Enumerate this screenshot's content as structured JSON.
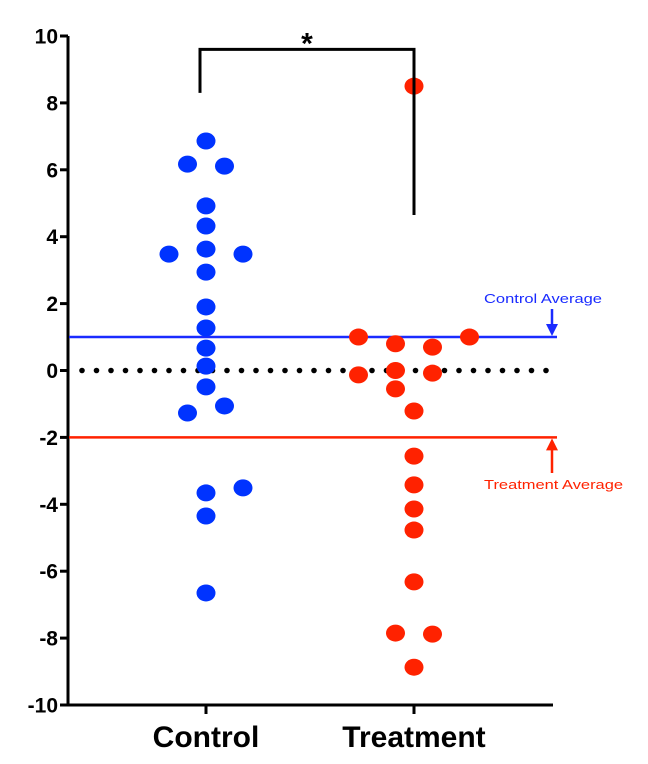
{
  "chart_data": {
    "type": "scatter",
    "title": "",
    "xlabel": "",
    "ylabel": "",
    "ylim": [
      -10,
      10
    ],
    "yticks": [
      10,
      8,
      6,
      4,
      2,
      0,
      -2,
      -4,
      -6,
      -8,
      -10
    ],
    "grid": false,
    "categories": [
      "Control",
      "Treatment"
    ],
    "series": [
      {
        "name": "Control",
        "color": "#0033ff",
        "points": [
          {
            "offset": 0,
            "y": 6.86
          },
          {
            "offset": -1,
            "y": 6.17
          },
          {
            "offset": 1,
            "y": 6.11
          },
          {
            "offset": 0,
            "y": 4.92
          },
          {
            "offset": 0,
            "y": 4.32
          },
          {
            "offset": 0,
            "y": 3.63
          },
          {
            "offset": -2,
            "y": 3.48
          },
          {
            "offset": 2,
            "y": 3.48
          },
          {
            "offset": 0,
            "y": 2.94
          },
          {
            "offset": 0,
            "y": 1.9
          },
          {
            "offset": 0,
            "y": 1.27
          },
          {
            "offset": 0,
            "y": 0.67
          },
          {
            "offset": 0,
            "y": 0.13
          },
          {
            "offset": 0,
            "y": -0.49
          },
          {
            "offset": 1,
            "y": -1.06
          },
          {
            "offset": -1,
            "y": -1.27
          },
          {
            "offset": 2,
            "y": -3.51
          },
          {
            "offset": 0,
            "y": -3.66
          },
          {
            "offset": 0,
            "y": -4.35
          },
          {
            "offset": 0,
            "y": -6.65
          }
        ]
      },
      {
        "name": "Treatment",
        "color": "#ff2200",
        "points": [
          {
            "offset": 0,
            "y": 8.5
          },
          {
            "offset": -3,
            "y": 1.0
          },
          {
            "offset": 3,
            "y": 1.0
          },
          {
            "offset": -1,
            "y": 0.8
          },
          {
            "offset": 1,
            "y": 0.7
          },
          {
            "offset": -1,
            "y": 0.0
          },
          {
            "offset": 1,
            "y": -0.08
          },
          {
            "offset": -3,
            "y": -0.13
          },
          {
            "offset": -1,
            "y": -0.55
          },
          {
            "offset": 0,
            "y": -1.21
          },
          {
            "offset": 0,
            "y": -2.56
          },
          {
            "offset": 0,
            "y": -3.42
          },
          {
            "offset": 0,
            "y": -4.14
          },
          {
            "offset": 0,
            "y": -4.77
          },
          {
            "offset": 0,
            "y": -6.32
          },
          {
            "offset": -1,
            "y": -7.85
          },
          {
            "offset": 1,
            "y": -7.88
          },
          {
            "offset": 0,
            "y": -8.87
          }
        ]
      }
    ],
    "reference_lines": [
      {
        "name": "Control Average",
        "y": 1,
        "color": "#1a2bff",
        "style": "solid",
        "label": "Control Average",
        "arrow": "down"
      },
      {
        "name": "Treatment Average",
        "y": -2,
        "color": "#ff2200",
        "style": "solid",
        "label": "Treatment Average",
        "arrow": "up"
      },
      {
        "name": "zero",
        "y": 0,
        "color": "#000000",
        "style": "dotted"
      }
    ],
    "significance": {
      "groups": [
        "Control",
        "Treatment"
      ],
      "marker": "*",
      "bracket_top": 9.6,
      "left_leg_end": 8.3,
      "right_leg_end": 4.65
    }
  }
}
